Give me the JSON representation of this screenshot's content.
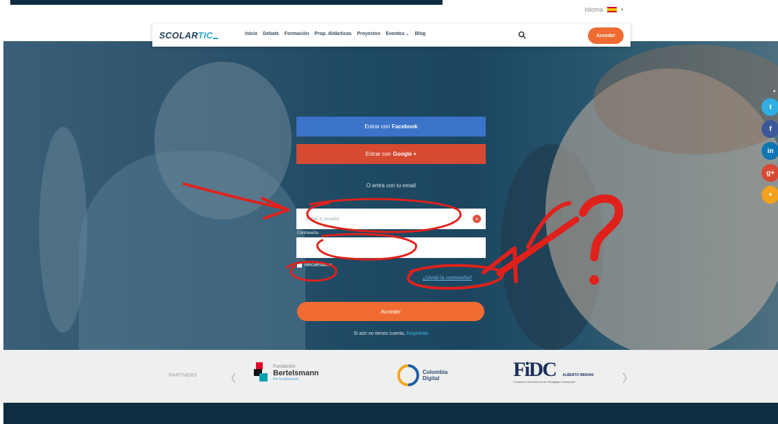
{
  "language": {
    "label": "Idioma"
  },
  "nav": {
    "logo_main": "SCOLAR",
    "logo_accent": "TIC",
    "items": [
      "Inicio",
      "Debate",
      "Formación",
      "Prop. didácticas",
      "Proyectos",
      "Eventos",
      "Blog"
    ],
    "login_button": "Acceder"
  },
  "login": {
    "facebook_prefix": "Entrar con",
    "facebook_brand": "Facebook",
    "google_prefix": "Entrar con",
    "google_brand": "Google +",
    "or_email": "O entra con tu email",
    "email_placeholder": "Email o usuario",
    "password_label": "Contraseña",
    "remember_label": "Recuérdame",
    "forgot_link": "¿Olvidó la contraseña?",
    "submit_button": "Acceder",
    "register_prefix": "Si aún no tienes cuenta,",
    "register_link": "Regístrate"
  },
  "partners": {
    "label": "PARTNERS",
    "items": [
      {
        "line1": "Fundación",
        "line2": "Bertelsmann",
        "line3": "Por la Educación"
      },
      {
        "line1": "Colombia",
        "line2": "Digital"
      },
      {
        "logo": "FiDC",
        "line1": "ALBERTO MERANI",
        "line2": "Fundación Internacional de Pedagogía Conceptual"
      }
    ]
  },
  "annotation": {
    "question_mark": "?"
  },
  "colors": {
    "brand_orange": "#ef6b32",
    "facebook_blue": "#3b73c8",
    "google_red": "#d64a32",
    "dark_navy": "#0f2d40",
    "annotation_red": "#e0211b"
  },
  "icons": {
    "search": "search-icon",
    "clear": "clear-input-icon",
    "social": [
      "twitter-icon",
      "facebook-icon",
      "linkedin-icon",
      "google-plus-icon",
      "share-icon"
    ]
  }
}
